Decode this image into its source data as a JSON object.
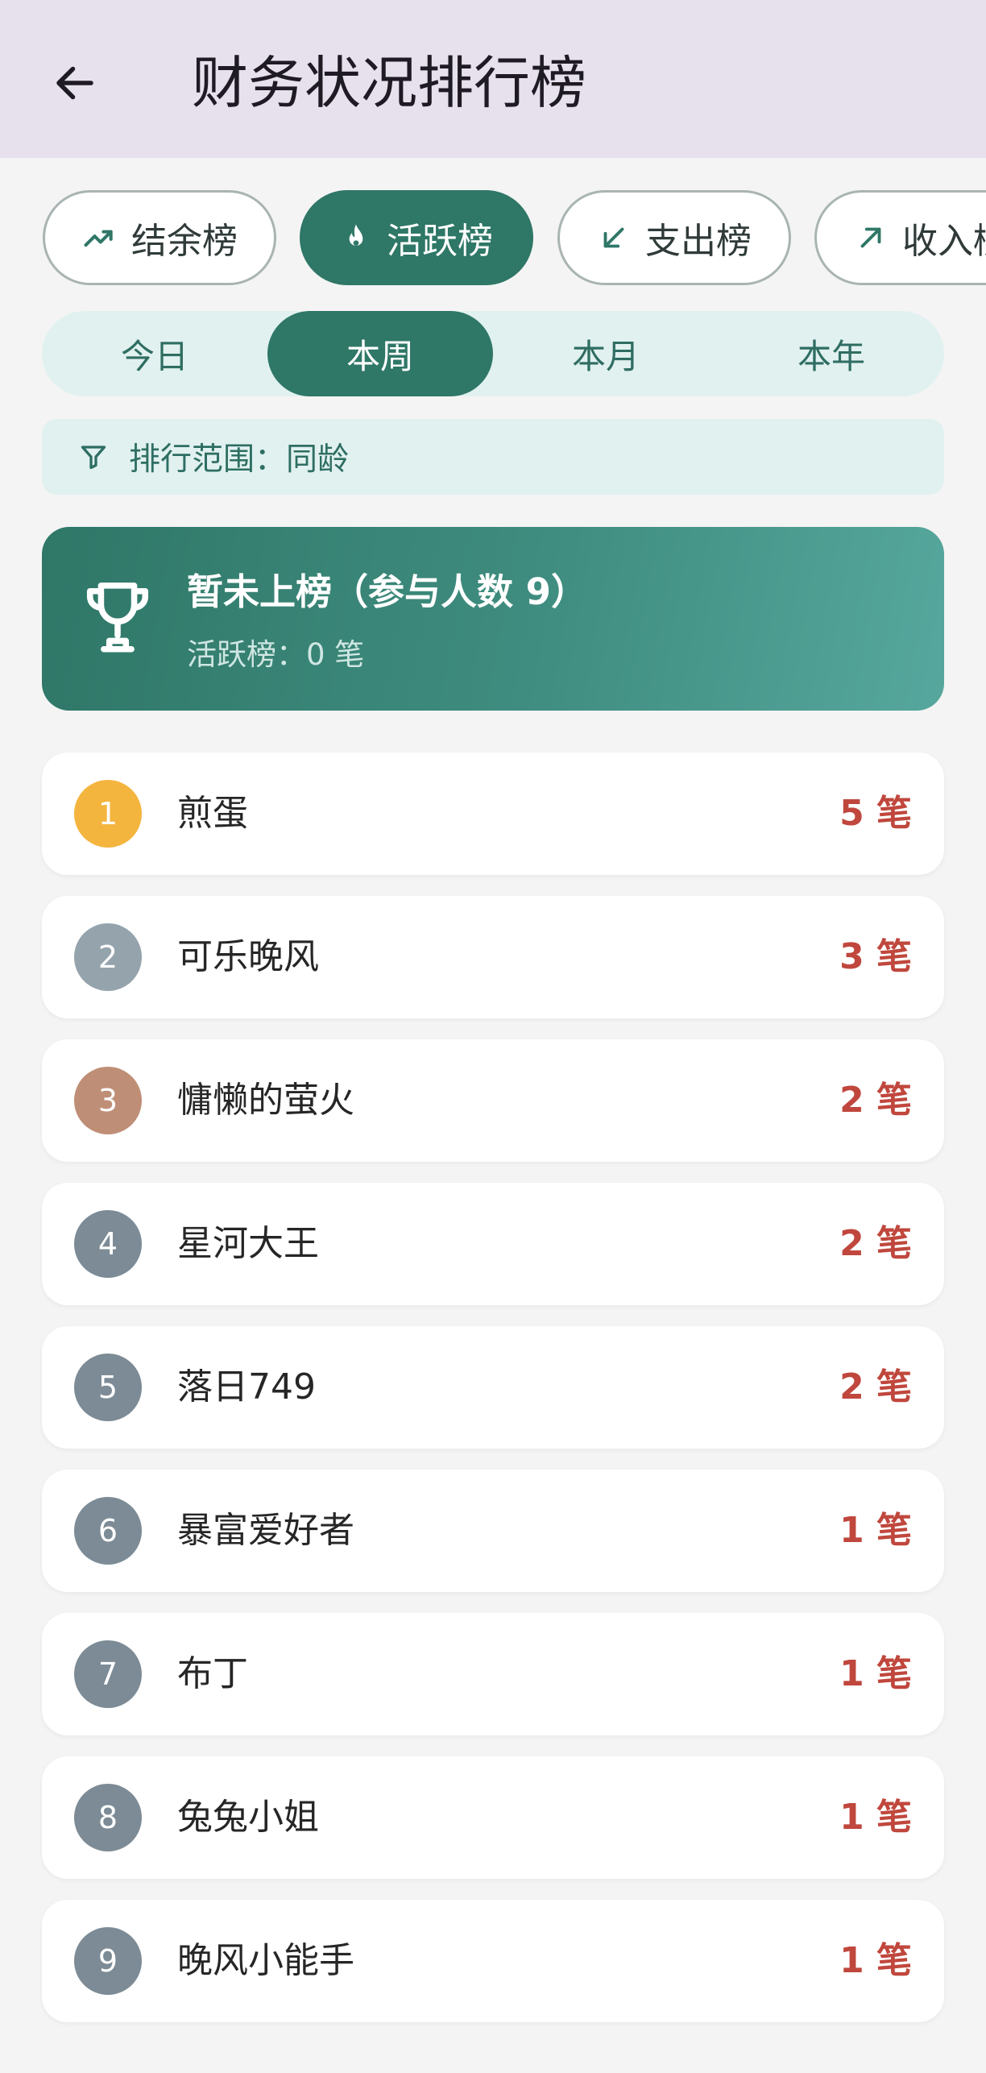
{
  "header": {
    "title": "财务状况排行榜",
    "back_icon": "arrow-left-icon"
  },
  "boards": [
    {
      "label": "结余榜",
      "icon": "trending-up-icon",
      "active": false
    },
    {
      "label": "活跃榜",
      "icon": "flame-icon",
      "active": true
    },
    {
      "label": "支出榜",
      "icon": "arrow-down-left-icon",
      "active": false
    },
    {
      "label": "收入榜",
      "icon": "arrow-up-right-icon",
      "active": false
    }
  ],
  "periods": [
    {
      "label": "今日",
      "active": false
    },
    {
      "label": "本周",
      "active": true
    },
    {
      "label": "本月",
      "active": false
    },
    {
      "label": "本年",
      "active": false
    }
  ],
  "filter": {
    "icon": "filter-icon",
    "text": "排行范围：同龄"
  },
  "status": {
    "icon": "trophy-icon",
    "title": "暂未上榜（参与人数 9）",
    "subtitle": "活跃榜：0 笔"
  },
  "ranking": [
    {
      "rank": "1",
      "name": "煎蛋",
      "value": "5 笔",
      "badge_color": "#f4b53f"
    },
    {
      "rank": "2",
      "name": "可乐晚风",
      "value": "3 笔",
      "badge_color": "#95a3ad"
    },
    {
      "rank": "3",
      "name": "慵懒的萤火",
      "value": "2 笔",
      "badge_color": "#bf8e76"
    },
    {
      "rank": "4",
      "name": "星河大王",
      "value": "2 笔",
      "badge_color": "#7c8b95"
    },
    {
      "rank": "5",
      "name": "落日749",
      "value": "2 笔",
      "badge_color": "#7c8b95"
    },
    {
      "rank": "6",
      "name": "暴富爱好者",
      "value": "1 笔",
      "badge_color": "#7c8b95"
    },
    {
      "rank": "7",
      "name": "布丁",
      "value": "1 笔",
      "badge_color": "#7c8b95"
    },
    {
      "rank": "8",
      "name": "兔兔小姐",
      "value": "1 笔",
      "badge_color": "#7c8b95"
    },
    {
      "rank": "9",
      "name": "晚风小能手",
      "value": "1 笔",
      "badge_color": "#7c8b95"
    }
  ],
  "colors": {
    "primary": "#2f7767",
    "app_bar": "#e7e1ee",
    "value_red": "#c0473d",
    "tint": "#e1f1f0"
  }
}
